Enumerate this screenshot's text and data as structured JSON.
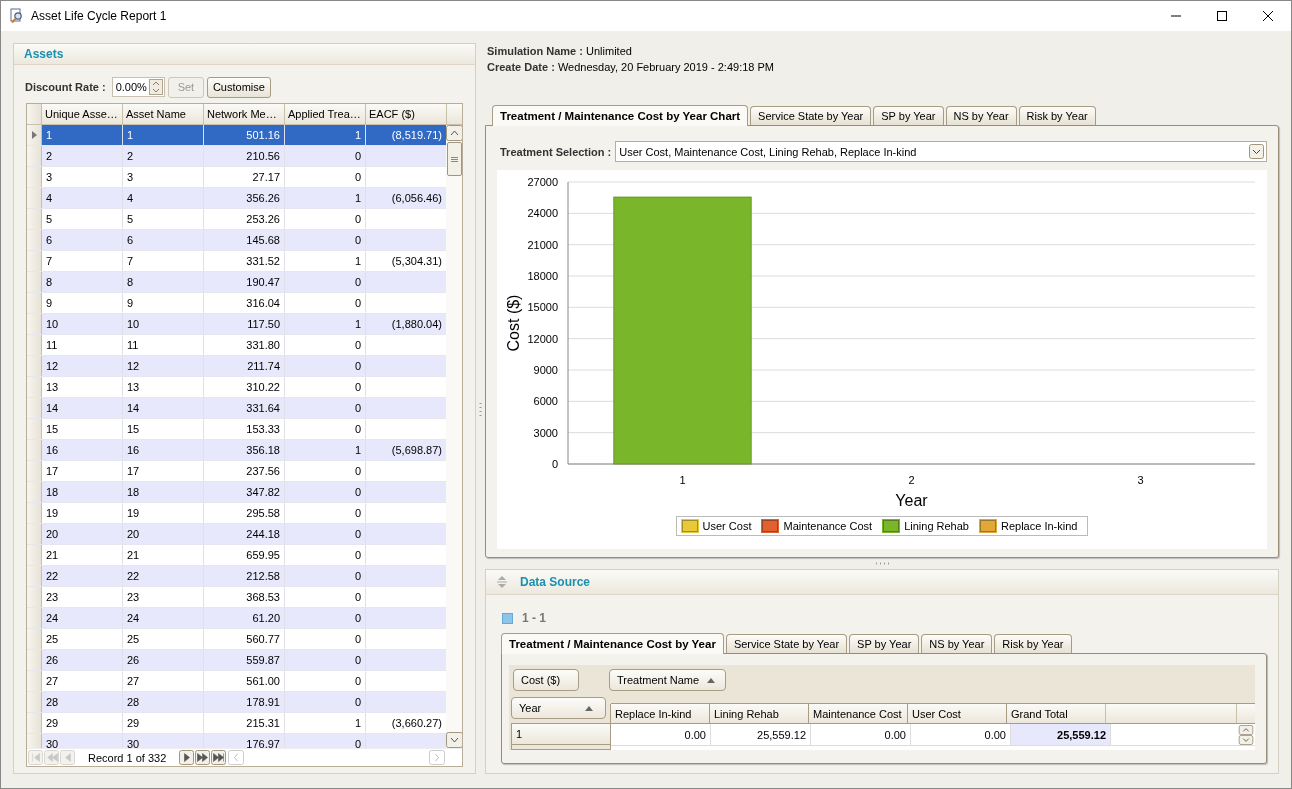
{
  "window": {
    "title": "Asset Life Cycle Report 1"
  },
  "assets": {
    "title": "Assets",
    "discount_label": "Discount Rate :",
    "discount_value": "0.00%",
    "set_button": {
      "label": "Set",
      "disabled": true
    },
    "customise_button": {
      "label": "Customise",
      "disabled": false
    },
    "columns": [
      "Unique Asse…",
      "Asset Name",
      "Network Me…",
      "Applied Trea…",
      "EACF ($)"
    ],
    "rows": [
      {
        "cells": [
          "1",
          "1",
          "501.16",
          "1",
          "(8,519.71)"
        ],
        "selected": true
      },
      {
        "cells": [
          "2",
          "2",
          "210.56",
          "0"
        ],
        "selected": false
      },
      {
        "cells": [
          "3",
          "3",
          "27.17",
          "0"
        ],
        "selected": false
      },
      {
        "cells": [
          "4",
          "4",
          "356.26",
          "1",
          "(6,056.46)"
        ],
        "selected": false
      },
      {
        "cells": [
          "5",
          "5",
          "253.26",
          "0"
        ],
        "selected": false
      },
      {
        "cells": [
          "6",
          "6",
          "145.68",
          "0"
        ],
        "selected": false
      },
      {
        "cells": [
          "7",
          "7",
          "331.52",
          "1",
          "(5,304.31)"
        ],
        "selected": false
      },
      {
        "cells": [
          "8",
          "8",
          "190.47",
          "0"
        ],
        "selected": false
      },
      {
        "cells": [
          "9",
          "9",
          "316.04",
          "0"
        ],
        "selected": false
      },
      {
        "cells": [
          "10",
          "10",
          "117.50",
          "1",
          "(1,880.04)"
        ],
        "selected": false
      },
      {
        "cells": [
          "11",
          "11",
          "331.80",
          "0"
        ],
        "selected": false
      },
      {
        "cells": [
          "12",
          "12",
          "211.74",
          "0"
        ],
        "selected": false
      },
      {
        "cells": [
          "13",
          "13",
          "310.22",
          "0"
        ],
        "selected": false
      },
      {
        "cells": [
          "14",
          "14",
          "331.64",
          "0"
        ],
        "selected": false
      },
      {
        "cells": [
          "15",
          "15",
          "153.33",
          "0"
        ],
        "selected": false
      },
      {
        "cells": [
          "16",
          "16",
          "356.18",
          "1",
          "(5,698.87)"
        ],
        "selected": false
      },
      {
        "cells": [
          "17",
          "17",
          "237.56",
          "0"
        ],
        "selected": false
      },
      {
        "cells": [
          "18",
          "18",
          "347.82",
          "0"
        ],
        "selected": false
      },
      {
        "cells": [
          "19",
          "19",
          "295.58",
          "0"
        ],
        "selected": false
      },
      {
        "cells": [
          "20",
          "20",
          "244.18",
          "0"
        ],
        "selected": false
      },
      {
        "cells": [
          "21",
          "21",
          "659.95",
          "0"
        ],
        "selected": false
      },
      {
        "cells": [
          "22",
          "22",
          "212.58",
          "0"
        ],
        "selected": false
      },
      {
        "cells": [
          "23",
          "23",
          "368.53",
          "0"
        ],
        "selected": false
      },
      {
        "cells": [
          "24",
          "24",
          "61.20",
          "0"
        ],
        "selected": false
      },
      {
        "cells": [
          "25",
          "25",
          "560.77",
          "0"
        ],
        "selected": false
      },
      {
        "cells": [
          "26",
          "26",
          "559.87",
          "0"
        ],
        "selected": false
      },
      {
        "cells": [
          "27",
          "27",
          "561.00",
          "0"
        ],
        "selected": false
      },
      {
        "cells": [
          "28",
          "28",
          "178.91",
          "0"
        ],
        "selected": false
      },
      {
        "cells": [
          "29",
          "29",
          "215.31",
          "1",
          "(3,660.27)"
        ],
        "selected": false
      },
      {
        "cells": [
          "30",
          "30",
          "176.97",
          "0"
        ],
        "selected": false
      }
    ],
    "pager": {
      "text": "Record 1 of 332",
      "buttons": [
        {
          "kind": "first",
          "disabled": true
        },
        {
          "kind": "prev-page",
          "disabled": true
        },
        {
          "kind": "prev",
          "disabled": true
        }
      ],
      "buttons_after": [
        {
          "kind": "next",
          "disabled": false
        },
        {
          "kind": "next-page",
          "disabled": false
        },
        {
          "kind": "last",
          "disabled": false
        }
      ]
    }
  },
  "simulation": {
    "name_label": "Simulation Name :",
    "name": "Unlimited",
    "date_label": "Create Date :",
    "date": "Wednesday, 20 February 2019 - 2:49:18 PM"
  },
  "chart_tabs": [
    {
      "label": "Treatment / Maintenance Cost by Year Chart",
      "selected": true
    },
    {
      "label": "Service State by Year",
      "selected": false
    },
    {
      "label": "SP by Year",
      "selected": false
    },
    {
      "label": "NS by Year",
      "selected": false
    },
    {
      "label": "Risk by Year",
      "selected": false
    }
  ],
  "treatment_selection": {
    "label": "Treatment Selection :",
    "value": "User Cost, Maintenance Cost, Lining Rehab, Replace In-kind"
  },
  "chart_data": {
    "type": "bar",
    "stacked": true,
    "grid": true,
    "xlabel": "Year",
    "ylabel": "Cost ($)",
    "categories": [
      "1",
      "2",
      "3"
    ],
    "ylim": [
      0,
      27000
    ],
    "yticks": [
      0,
      3000,
      6000,
      9000,
      12000,
      15000,
      18000,
      21000,
      24000,
      27000
    ],
    "series": [
      {
        "name": "User Cost",
        "color": "#e8c93a",
        "values": [
          0,
          0,
          0
        ]
      },
      {
        "name": "Maintenance Cost",
        "color": "#e06030",
        "values": [
          0,
          0,
          0
        ]
      },
      {
        "name": "Lining Rehab",
        "color": "#7ab62a",
        "values": [
          25560,
          0,
          0
        ]
      },
      {
        "name": "Replace In-kind",
        "color": "#e0a838",
        "values": [
          0,
          0,
          0
        ]
      }
    ]
  },
  "data_source": {
    "title": "Data Source",
    "group": "1 - 1",
    "tabs": [
      {
        "label": "Treatment / Maintenance Cost by Year",
        "selected": true
      },
      {
        "label": "Service State by Year",
        "selected": false
      },
      {
        "label": "SP by Year",
        "selected": false
      },
      {
        "label": "NS by Year",
        "selected": false
      },
      {
        "label": "Risk by Year",
        "selected": false
      }
    ],
    "data_field": "Cost ($)",
    "column_field": "Treatment Name",
    "row_field": "Year",
    "columns": [
      "Replace In-kind",
      "Lining Rehab",
      "Maintenance Cost",
      "User Cost",
      "Grand Total"
    ],
    "rows": [
      {
        "header": "1",
        "cells": [
          "0.00",
          "25,559.12",
          "0.00",
          "0.00",
          "25,559.12"
        ]
      }
    ]
  }
}
